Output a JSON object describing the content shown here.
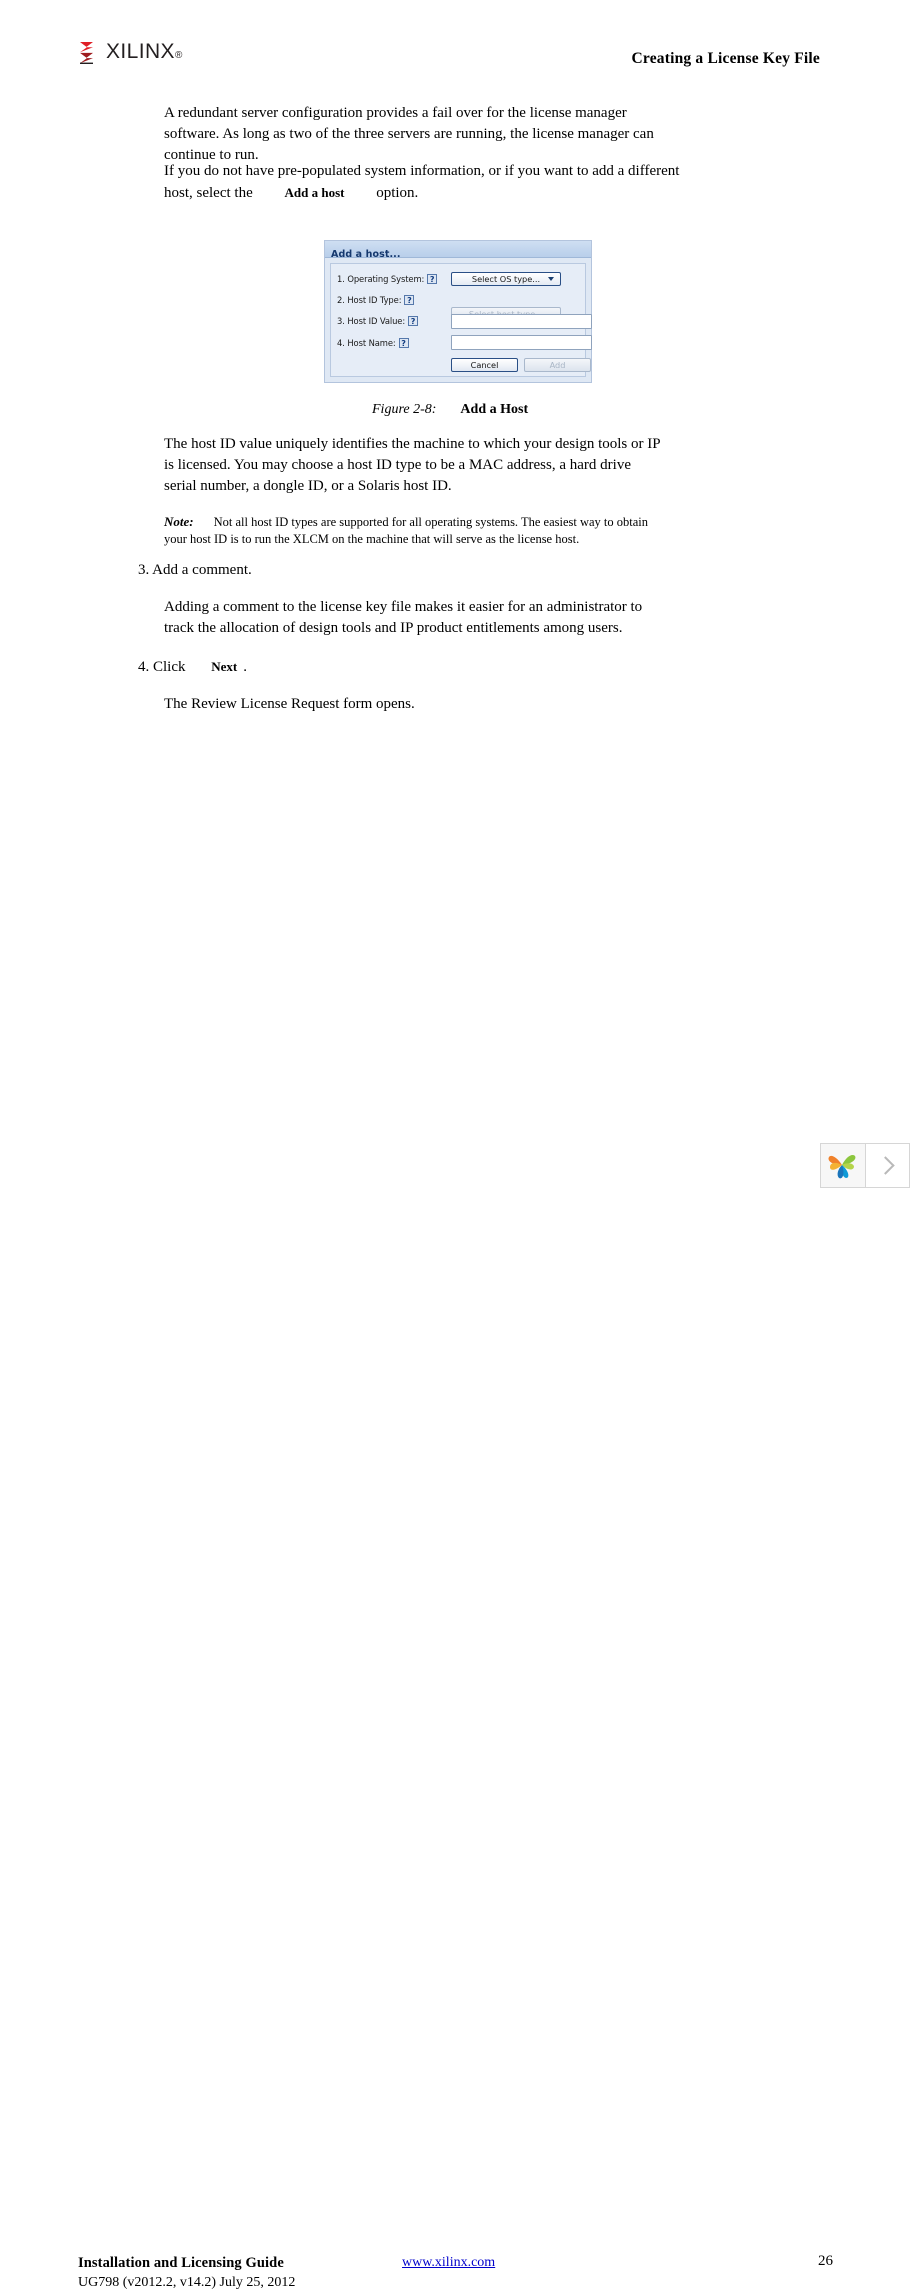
{
  "header": {
    "logo_text": "XILINX",
    "logo_registered": "®",
    "logo_icon": "xilinx-sigma-logo",
    "title": "Creating a License Key File"
  },
  "body": {
    "paragraph_1": "A redundant server configuration provides a fail over for the license manager software. As long as two of the three servers are running, the license manager can continue to run.",
    "paragraph_2_part1": "If you do not have pre-populated system information, or if you want to add a different host, select the",
    "paragraph_2_bold": "Add a host",
    "paragraph_2_part2": "option.",
    "paragraph_3": "The host ID value uniquely identifies the machine to which your design tools or IP is licensed. You may choose a host ID type to be a MAC address, a hard drive serial number, a dongle ID, or a Solaris host ID.",
    "note_keyword": "Note:",
    "note_text": "Not all host ID types are supported for all operating systems. The easiest way to obtain your host ID is to run the XLCM on the machine that will serve as the license host.",
    "step_3_heading": "3. Add a comment.",
    "step_3_body": "Adding a comment to the license key file makes it easier for an administrator to track the allocation of design tools and IP product entitlements among users.",
    "step_4_prefix": "4. Click",
    "step_4_bold": "Next",
    "step_4_suffix": ".",
    "step_4_body": "The Review License Request form opens."
  },
  "figure": {
    "number": "Figure 2-8:",
    "label": "Add a Host"
  },
  "dialog": {
    "title": "Add a host...",
    "fields": [
      {
        "label": "1. Operating System:",
        "help": "?",
        "control": "combo",
        "value": "Select OS type...",
        "disabled": false
      },
      {
        "label": "2. Host ID Type:",
        "help": "?",
        "control": "combo",
        "value": "Select host type...",
        "disabled": true
      },
      {
        "label": "3. Host ID Value:",
        "help": "?",
        "control": "text",
        "value": "",
        "disabled": false
      },
      {
        "label": "4. Host Name:",
        "help": "?",
        "control": "text",
        "value": "",
        "disabled": false
      }
    ],
    "buttons": {
      "cancel": "Cancel",
      "add": "Add"
    }
  },
  "footer": {
    "guide_title": "Installation and Licensing Guide",
    "doc_id": "UG798 (v2012.2, v14.2) July 25, 2012",
    "link": "www.xilinx.com",
    "page_number": "26"
  },
  "widget": {
    "logo_icon": "colored-leaf-logo",
    "next_icon": "chevron-right-icon"
  },
  "colors": {
    "brand_red": "#e01f26",
    "link_blue": "#0000cc",
    "dialog_title_text": "#15386e",
    "dialog_body_bg": "#e6edf7",
    "dialog_outer_bg": "#dfe8f4"
  }
}
